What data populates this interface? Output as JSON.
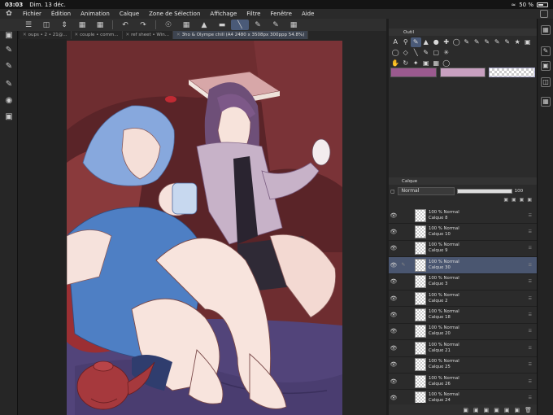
{
  "status": {
    "time": "03:03",
    "date": "Dim. 13 déc.",
    "battery": "50 %"
  },
  "menu": {
    "items": [
      "Fichier",
      "Édition",
      "Animation",
      "Calque",
      "Zone de Sélection",
      "Affichage",
      "Filtre",
      "Fenêtre",
      "Aide"
    ]
  },
  "tabs": [
    {
      "label": "oups • 2 • 21@...",
      "active": false
    },
    {
      "label": "couple • comm...",
      "active": false
    },
    {
      "label": "ref sheet • Win...",
      "active": false
    },
    {
      "label": "3ho & Olympe chill (A4 2480 x 3508px 300ppp 54.8%)",
      "active": true
    }
  ],
  "tool_panel": {
    "title": "Outil"
  },
  "layer_panel": {
    "title": "Calque",
    "blend_mode": "Normal",
    "opacity": "100"
  },
  "layers": [
    {
      "opacity": "100 % Normal",
      "name": "Calque 8",
      "selected": false
    },
    {
      "opacity": "100 % Normal",
      "name": "Calque 10",
      "selected": false
    },
    {
      "opacity": "100 % Normal",
      "name": "Calque 9",
      "selected": false
    },
    {
      "opacity": "100 % Normal",
      "name": "Calque 30",
      "selected": true
    },
    {
      "opacity": "100 % Normal",
      "name": "Calque 3",
      "selected": false
    },
    {
      "opacity": "100 % Normal",
      "name": "Calque 2",
      "selected": false
    },
    {
      "opacity": "100 % Normal",
      "name": "Calque 18",
      "selected": false
    },
    {
      "opacity": "100 % Normal",
      "name": "Calque 20",
      "selected": false
    },
    {
      "opacity": "100 % Normal",
      "name": "Calque 21",
      "selected": false
    },
    {
      "opacity": "100 % Normal",
      "name": "Calque 25",
      "selected": false
    },
    {
      "opacity": "100 % Normal",
      "name": "Calque 26",
      "selected": false
    },
    {
      "opacity": "100 % Normal",
      "name": "Calque 24",
      "selected": false
    }
  ],
  "colors": {
    "accent": "#4a5a78",
    "selected_layer": "#4a5670"
  }
}
